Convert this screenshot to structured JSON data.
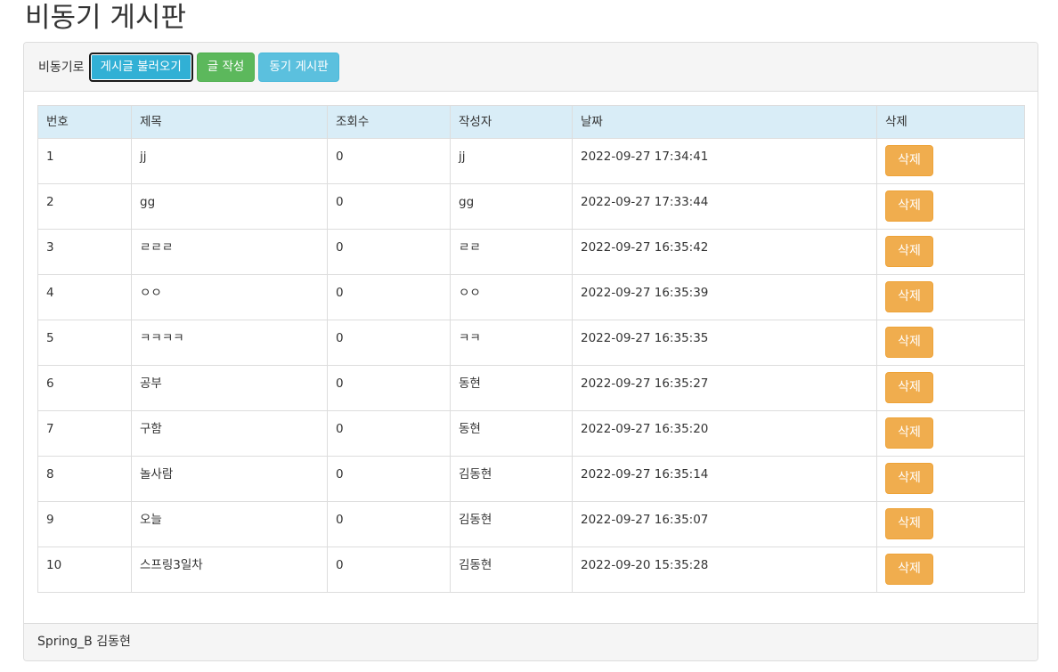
{
  "page": {
    "title": "비동기 게시판"
  },
  "toolbar": {
    "label": "비동기로",
    "load_button": "게시글 불러오기",
    "write_button": "글 작성",
    "sync_board_button": "동기 게시판"
  },
  "table": {
    "headers": {
      "no": "번호",
      "title": "제목",
      "views": "조회수",
      "author": "작성자",
      "date": "날짜",
      "delete": "삭제"
    },
    "rows": [
      {
        "no": "1",
        "title": "jj",
        "views": "0",
        "author": "jj",
        "date": "2022-09-27 17:34:41",
        "delete_label": "삭제"
      },
      {
        "no": "2",
        "title": "gg",
        "views": "0",
        "author": "gg",
        "date": "2022-09-27 17:33:44",
        "delete_label": "삭제"
      },
      {
        "no": "3",
        "title": "ㄹㄹㄹ",
        "views": "0",
        "author": "ㄹㄹ",
        "date": "2022-09-27 16:35:42",
        "delete_label": "삭제"
      },
      {
        "no": "4",
        "title": "ㅇㅇ",
        "views": "0",
        "author": "ㅇㅇ",
        "date": "2022-09-27 16:35:39",
        "delete_label": "삭제"
      },
      {
        "no": "5",
        "title": "ㅋㅋㅋㅋ",
        "views": "0",
        "author": "ㅋㅋ",
        "date": "2022-09-27 16:35:35",
        "delete_label": "삭제"
      },
      {
        "no": "6",
        "title": "공부",
        "views": "0",
        "author": "동현",
        "date": "2022-09-27 16:35:27",
        "delete_label": "삭제"
      },
      {
        "no": "7",
        "title": "구함",
        "views": "0",
        "author": "동현",
        "date": "2022-09-27 16:35:20",
        "delete_label": "삭제"
      },
      {
        "no": "8",
        "title": "놀사람",
        "views": "0",
        "author": "김동현",
        "date": "2022-09-27 16:35:14",
        "delete_label": "삭제"
      },
      {
        "no": "9",
        "title": "오늘",
        "views": "0",
        "author": "김동현",
        "date": "2022-09-27 16:35:07",
        "delete_label": "삭제"
      },
      {
        "no": "10",
        "title": "스프링3일차",
        "views": "0",
        "author": "김동현",
        "date": "2022-09-20 15:35:28",
        "delete_label": "삭제"
      }
    ]
  },
  "footer": {
    "text": "Spring_B 김동현"
  },
  "colors": {
    "info": "#5bc0de",
    "success": "#5cb85c",
    "warning": "#f0ad4e",
    "table_header_bg": "#d9edf7"
  }
}
